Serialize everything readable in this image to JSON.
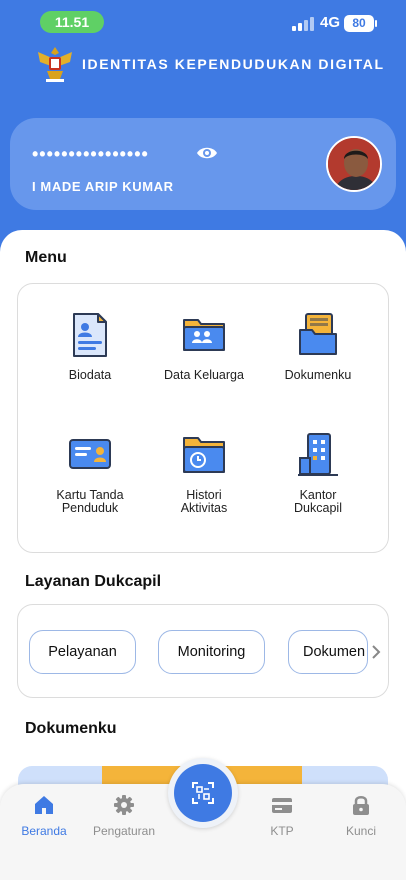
{
  "status_bar": {
    "time": "11.51",
    "network": "4G",
    "battery": "80"
  },
  "header": {
    "app_title": "IDENTITAS KEPENDUDUKAN DIGITAL",
    "logo_icon": "garuda-emblem"
  },
  "profile": {
    "masked_nik": "••••••••••••••••",
    "name": "I MADE ARIP KUMAR",
    "show_icon": "eye-icon"
  },
  "menu": {
    "title": "Menu",
    "items": [
      {
        "label_1": "Biodata",
        "label_2": "",
        "icon": "biodata-icon"
      },
      {
        "label_1": "Data Keluarga",
        "label_2": "",
        "icon": "family-folder-icon"
      },
      {
        "label_1": "Dokumenku",
        "label_2": "",
        "icon": "documents-icon"
      },
      {
        "label_1": "Kartu Tanda",
        "label_2": "Penduduk",
        "icon": "id-card-icon"
      },
      {
        "label_1": "Histori",
        "label_2": "Aktivitas",
        "icon": "history-folder-icon"
      },
      {
        "label_1": "Kantor",
        "label_2": "Dukcapil",
        "icon": "office-building-icon"
      }
    ]
  },
  "layanan": {
    "title": "Layanan Dukcapil",
    "chips": [
      "Pelayanan",
      "Monitoring",
      "Dokumen"
    ]
  },
  "dokumenku": {
    "title": "Dokumenku"
  },
  "bottom_nav": {
    "items": [
      {
        "label": "Beranda",
        "icon": "home-icon",
        "active": true
      },
      {
        "label": "Pengaturan",
        "icon": "gear-icon",
        "active": false
      },
      {
        "label": "KTP",
        "icon": "card-icon",
        "active": false
      },
      {
        "label": "Kunci",
        "icon": "lock-icon",
        "active": false
      }
    ],
    "scan_icon": "qr-scan-icon"
  },
  "colors": {
    "primary": "#3f7ae3",
    "card": "#6797ec",
    "accent": "#f4b43a",
    "time_pill": "#5fd065"
  }
}
